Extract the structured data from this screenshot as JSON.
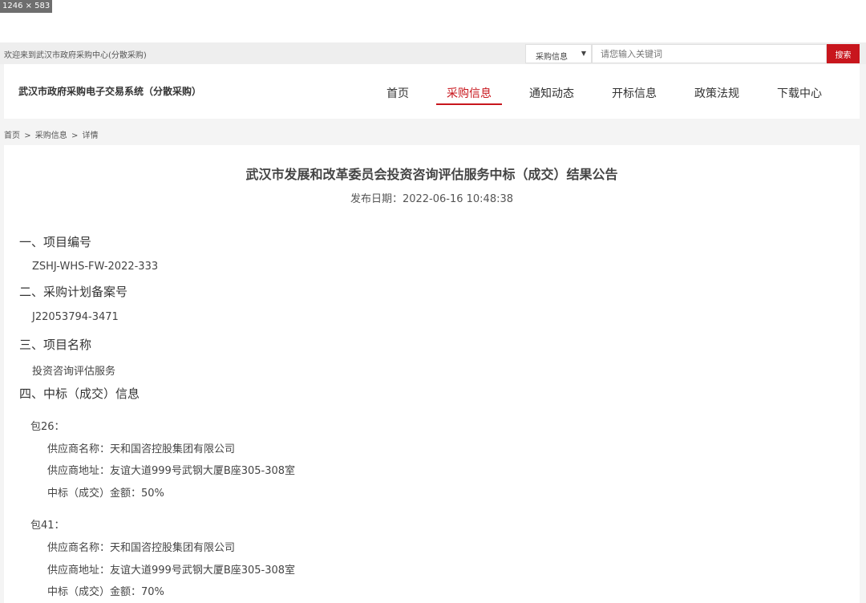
{
  "dimension_badge": "1246 × 583",
  "topbar": {
    "welcome": "欢迎来到武汉市政府采购中心(分散采购)",
    "search_category": "采购信息",
    "search_placeholder": "请您输入关键词",
    "search_button": "搜索"
  },
  "header": {
    "site_title": "武汉市政府采购电子交易系统（分散采购）",
    "nav": [
      "首页",
      "采购信息",
      "通知动态",
      "开标信息",
      "政策法规",
      "下载中心"
    ],
    "active_nav": "采购信息"
  },
  "breadcrumb": [
    "首页",
    ">",
    "采购信息",
    ">",
    "详情"
  ],
  "notice": {
    "title": "武汉市发展和改革委员会投资咨询评估服务中标（成交）结果公告",
    "date": "发布日期：2022-06-16 10:48:38",
    "sections": [
      {
        "heading": "一、项目编号",
        "value": "ZSHJ-WHS-FW-2022-333"
      },
      {
        "heading": "二、采购计划备案号",
        "value": "J22053794-3471"
      },
      {
        "heading": "三、项目名称",
        "value": "投资咨询评估服务"
      },
      {
        "heading": "四、中标（成交）信息"
      }
    ],
    "packages": [
      {
        "name": "包26：",
        "supplier": "供应商名称：天和国咨控股集团有限公司",
        "address": "供应商地址：友谊大道999号武钢大厦B座305-308室",
        "amount": "中标（成交）金额：50%"
      },
      {
        "name": "包41：",
        "supplier": "供应商名称：天和国咨控股集团有限公司",
        "address": "供应商地址：友谊大道999号武钢大厦B座305-308室",
        "amount": "中标（成交）金额：70%"
      }
    ]
  },
  "colors": {
    "accent": "#c8161d",
    "page_background": "#f4f4f4",
    "panel": "#ffffff"
  }
}
